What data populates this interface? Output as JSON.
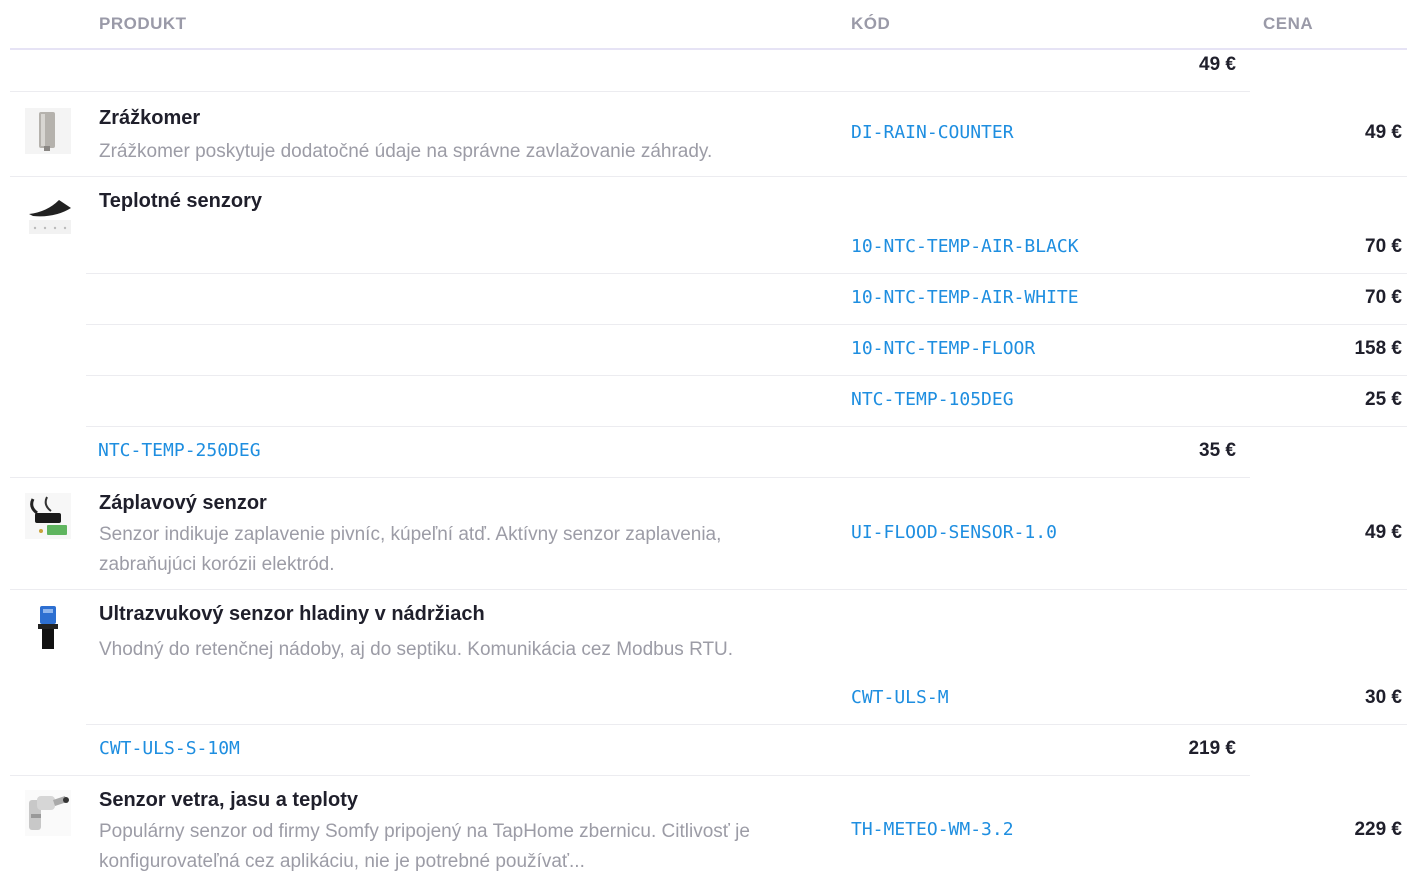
{
  "header": {
    "product": "PRODUKT",
    "code": "KÓD",
    "price": "CENA"
  },
  "rows": {
    "top_price": "49 €",
    "rain": {
      "name": "Zrážkomer",
      "desc": "Zrážkomer poskytuje dodatočné údaje na správne zavlažovanie záhrady.",
      "code": "DI-RAIN-COUNTER",
      "price": "49 €"
    },
    "temp": {
      "name": "Teplotné senzory",
      "variants": [
        {
          "code": "10-NTC-TEMP-AIR-BLACK",
          "price": "70 €"
        },
        {
          "code": "10-NTC-TEMP-AIR-WHITE",
          "price": "70 €"
        },
        {
          "code": "10-NTC-TEMP-FLOOR",
          "price": "158 €"
        },
        {
          "code": "NTC-TEMP-105DEG",
          "price": "25 €"
        },
        {
          "code": "NTC-TEMP-250DEG",
          "price": "35 €"
        }
      ]
    },
    "flood": {
      "name": "Záplavový senzor",
      "desc": "Senzor indikuje zaplavenie pivníc, kúpeľní atď. Aktívny senzor zaplavenia, zabraňujúci korózii elektród.",
      "code": "UI-FLOOD-SENSOR-1.0",
      "price": "49 €"
    },
    "uls": {
      "name": "Ultrazvukový senzor hladiny v nádržiach",
      "desc": "Vhodný do retenčnej nádoby, aj do septiku. Komunikácia cez Modbus RTU.",
      "variants": [
        {
          "code": "CWT-ULS-M",
          "price": "30 €"
        },
        {
          "code": "CWT-ULS-S-10M",
          "price": "219 €"
        }
      ]
    },
    "meteo": {
      "name": "Senzor vetra, jasu a teploty",
      "desc": "Populárny senzor od firmy Somfy pripojený na TapHome zbernicu. Citlivosť je konfigurovateľná cez aplikáciu, nie je potrebné používať...",
      "code": "TH-METEO-WM-3.2",
      "price": "229 €"
    }
  },
  "icons": {
    "rain": "rain-gauge-icon",
    "temp": "temperature-probe-icon",
    "flood": "flood-sensor-icon",
    "uls": "ultrasonic-sensor-icon",
    "meteo": "weather-sensor-icon"
  },
  "colors": {
    "code_link": "#1e8ee0",
    "header_text": "#9a9aa8",
    "description": "#9c9ca6"
  }
}
